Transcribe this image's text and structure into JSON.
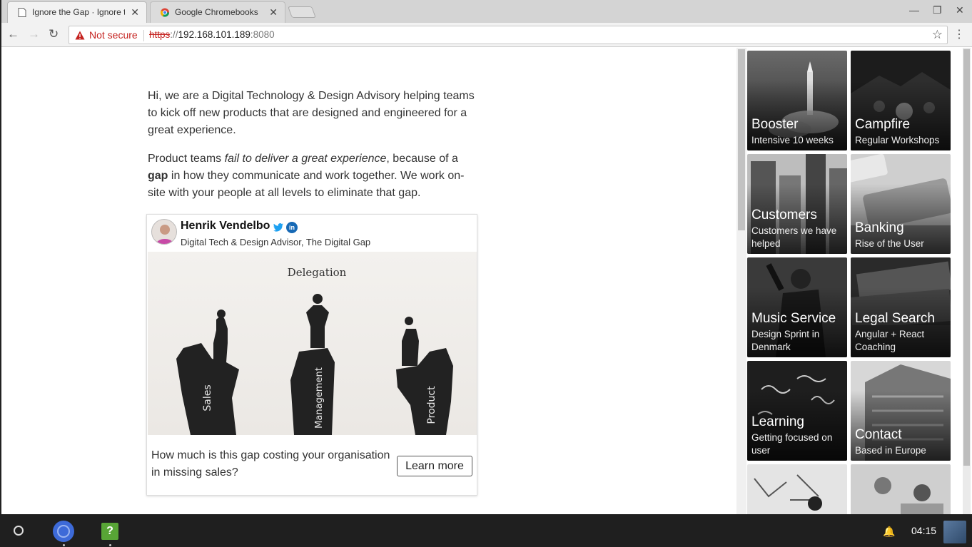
{
  "browser": {
    "tabs": [
      {
        "title": "Ignore the Gap · Ignore the",
        "close": "✕"
      },
      {
        "title": "Google Chromebooks",
        "close": "✕"
      }
    ],
    "not_secure_label": "Not secure",
    "url_scheme": "https",
    "url_sep": "://",
    "url_host": "192.168.101.189",
    "url_port": ":8080"
  },
  "page": {
    "intro_text": "Hi, we are a Digital Technology & Design Advisory helping teams to kick off new products that are designed and engineered for a great experience.",
    "para2_a": "Product teams ",
    "para2_em": "fail to deliver a great experience",
    "para2_b": ", because of a ",
    "para2_strong": "gap",
    "para2_c": " in how they communicate and work together. We work on-site with your people at all levels to eliminate that gap.",
    "card": {
      "author_name": "Henrik Vendelbo",
      "author_role": "Digital Tech & Design Advisor, The Digital Gap",
      "linkedin": "in",
      "image_labels": {
        "top": "Delegation",
        "left": "Sales",
        "middle": "Management",
        "right": "Product"
      },
      "question": "How much is this gap costing your organisation in missing sales?",
      "cta": "Learn more"
    }
  },
  "tiles": [
    {
      "title": "Booster",
      "subtitle": "Intensive 10 weeks"
    },
    {
      "title": "Campfire",
      "subtitle": "Regular Workshops"
    },
    {
      "title": "Customers",
      "subtitle": "Customers we have helped"
    },
    {
      "title": "Banking",
      "subtitle": "Rise of the User"
    },
    {
      "title": "Music Service",
      "subtitle": "Design Sprint in Denmark"
    },
    {
      "title": "Legal Search",
      "subtitle": "Angular + React Coaching"
    },
    {
      "title": "Learning",
      "subtitle": "Getting focused on user"
    },
    {
      "title": "Contact",
      "subtitle": "Based in Europe"
    },
    {
      "title": "",
      "subtitle": ""
    },
    {
      "title": "",
      "subtitle": ""
    }
  ],
  "shelf": {
    "help_app": "?",
    "time": "04:15"
  },
  "colors": {
    "not_secure": "#c5221f",
    "linkedin": "#1769b5",
    "twitter": "#1da1f2"
  }
}
